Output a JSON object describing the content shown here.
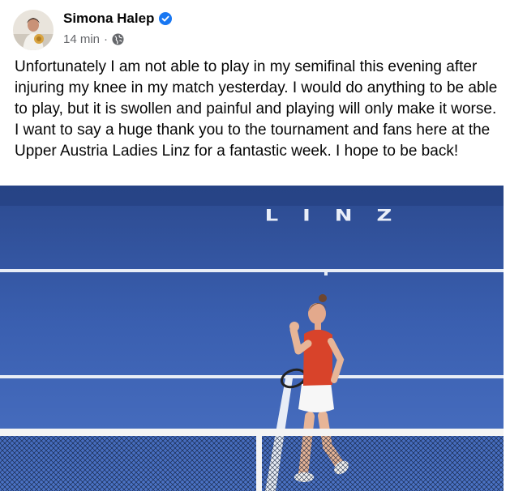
{
  "post": {
    "author": "Simona Halep",
    "time": "14 min",
    "separator": "·",
    "text": "Unfortunately I am not able to play in my semifinal this evening after injuring my knee in my match yesterday. I would do anything to be able to play, but it is swollen and painful and playing will only make it worse. I want to say a huge thank you to the tournament and fans here at the Upper Austria Ladies Linz for a fantastic week. I hope to be back!"
  },
  "photo": {
    "court_text": "LINZ"
  },
  "icons": {
    "verified": "verified-badge-icon",
    "audience": "globe-icon"
  },
  "colors": {
    "verified_blue": "#1877f2",
    "court_blue": "#3a5fb0",
    "shirt_red": "#d8432a"
  }
}
